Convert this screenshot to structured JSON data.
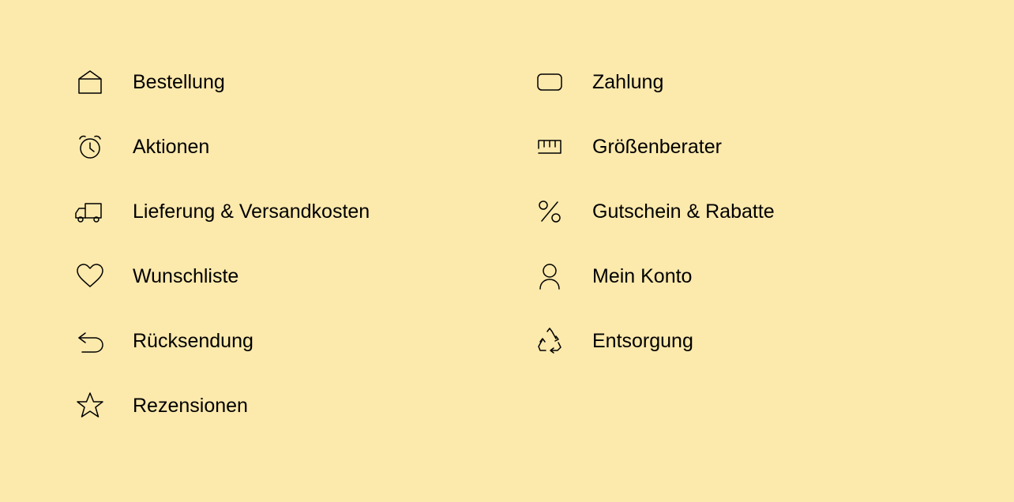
{
  "menu": {
    "left": [
      {
        "label": "Bestellung",
        "icon": "order"
      },
      {
        "label": "Aktionen",
        "icon": "clock"
      },
      {
        "label": "Lieferung & Versandkosten",
        "icon": "delivery"
      },
      {
        "label": "Wunschliste",
        "icon": "heart"
      },
      {
        "label": "Rücksendung",
        "icon": "return"
      },
      {
        "label": "Rezensionen",
        "icon": "star"
      }
    ],
    "right": [
      {
        "label": "Zahlung",
        "icon": "card"
      },
      {
        "label": "Größenberater",
        "icon": "ruler"
      },
      {
        "label": "Gutschein & Rabatte",
        "icon": "percent"
      },
      {
        "label": "Mein Konto",
        "icon": "user"
      },
      {
        "label": "Entsorgung",
        "icon": "recycle"
      }
    ]
  }
}
